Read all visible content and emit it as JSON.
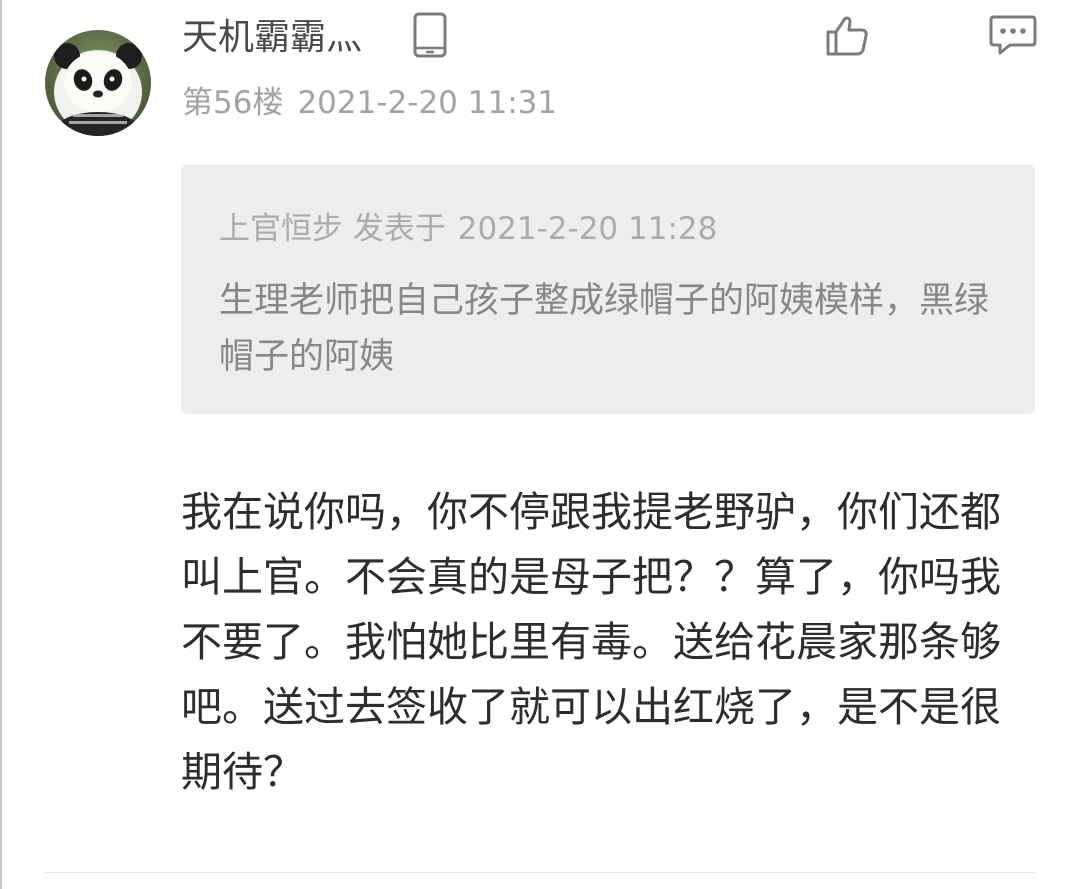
{
  "post": {
    "username": "天机霸霸灬",
    "floor": "第56楼",
    "timestamp": "2021-2-20 11:31",
    "device_icon": "phone-icon",
    "actions": {
      "like_icon": "thumbs-up-icon",
      "reply_icon": "comment-icon"
    }
  },
  "quote": {
    "author": "上官恒步",
    "posted_label": "发表于",
    "timestamp": "2021-2-20 11:28",
    "text": "生理老师把自己孩子整成绿帽子的阿姨模样，黑绿帽子的阿姨"
  },
  "content": {
    "text": "我在说你吗，你不停跟我提老野驴，你们还都叫上官。不会真的是母子把？？算了，你吗我不要了。我怕她比里有毒。送给花晨家那条够吧。送过去签收了就可以出红烧了，是不是很期待？"
  }
}
